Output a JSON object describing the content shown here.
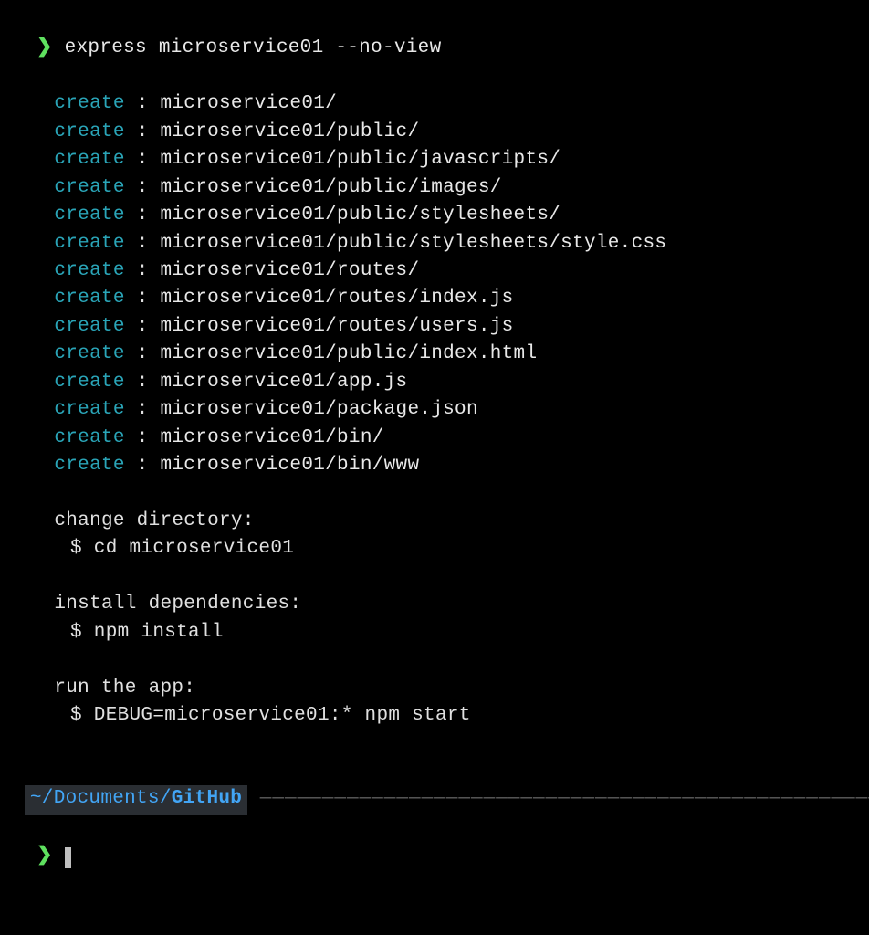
{
  "prompt1": {
    "symbol": "❯",
    "command": "express microservice01 --no-view"
  },
  "create_label": "create",
  "create_paths": [
    "microservice01/",
    "microservice01/public/",
    "microservice01/public/javascripts/",
    "microservice01/public/images/",
    "microservice01/public/stylesheets/",
    "microservice01/public/stylesheets/style.css",
    "microservice01/routes/",
    "microservice01/routes/index.js",
    "microservice01/routes/users.js",
    "microservice01/public/index.html",
    "microservice01/app.js",
    "microservice01/package.json",
    "microservice01/bin/",
    "microservice01/bin/www"
  ],
  "instructions": {
    "change_dir": {
      "label": "change directory:",
      "cmd": "$ cd microservice01"
    },
    "install": {
      "label": "install dependencies:",
      "cmd": "$ npm install"
    },
    "run": {
      "label": "run the app:",
      "cmd": "$ DEBUG=microservice01:* npm start"
    }
  },
  "cwd": {
    "prefix": "~/Documents/",
    "repo": "GitHub"
  },
  "dashes": " ———————————————————————————————————————————————————",
  "prompt2": {
    "symbol": "❯"
  }
}
